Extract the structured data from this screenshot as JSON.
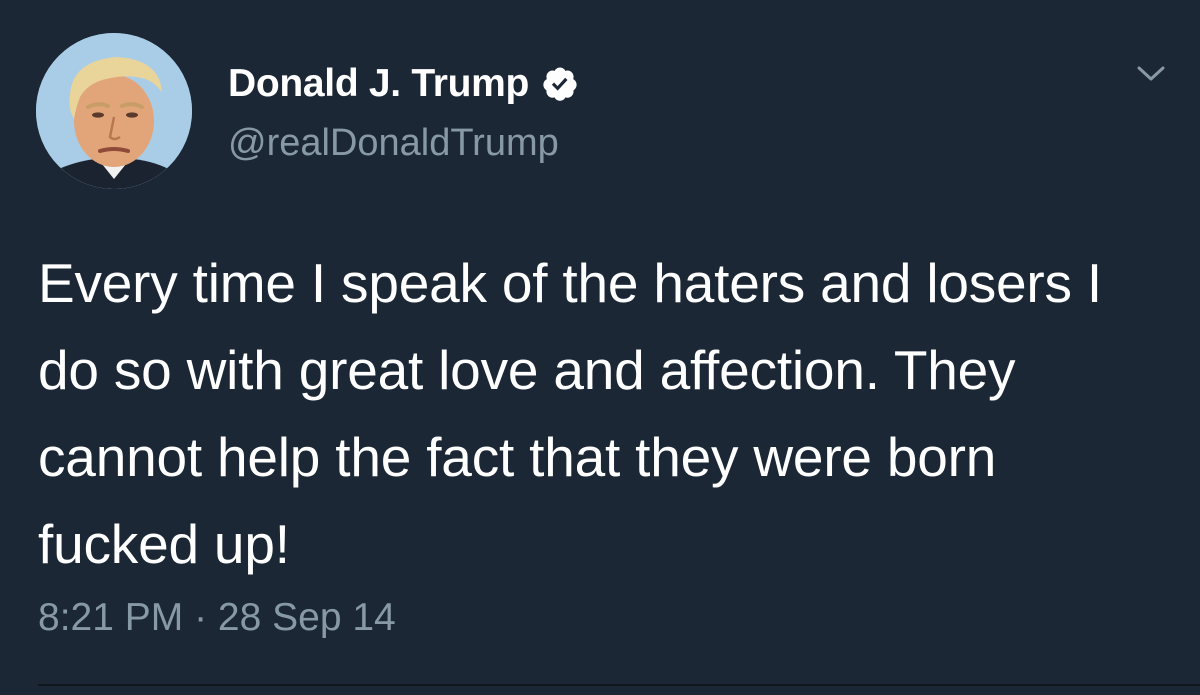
{
  "tweet": {
    "author": {
      "display_name": "Donald J. Trump",
      "handle": "@realDonaldTrump",
      "verified": true
    },
    "text": "Every time I speak of the haters and losers I do so with great love and affection. They cannot help the fact that they were born fucked up!",
    "timestamp": "8:21 PM · 28 Sep 14"
  },
  "icons": {
    "verified": "verified-badge-icon",
    "menu": "chevron-down-icon"
  },
  "colors": {
    "background": "#1b2735",
    "primary_text": "#ffffff",
    "secondary_text": "#8899a6",
    "avatar_background": "#a9cde6"
  }
}
